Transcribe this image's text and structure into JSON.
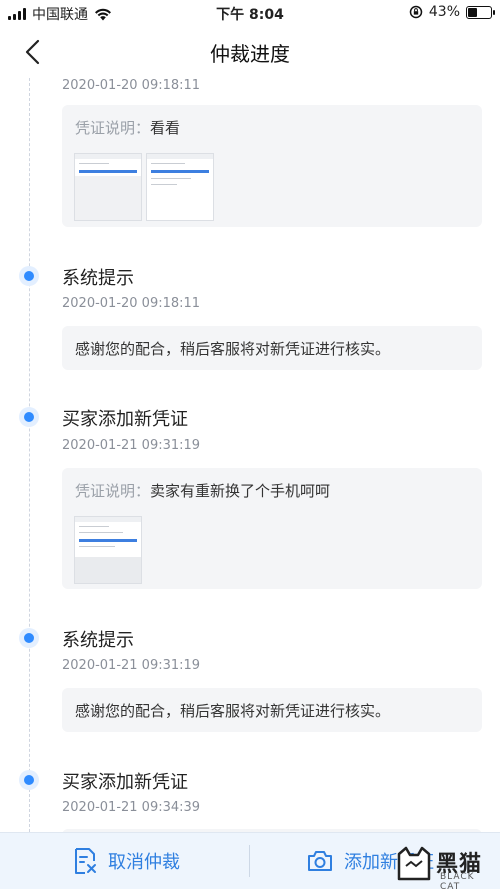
{
  "status_bar": {
    "carrier": "中国联通",
    "time": "下午 8:04",
    "battery_percent": "43%",
    "battery_level": 0.43
  },
  "nav": {
    "title": "仲裁进度"
  },
  "timeline": {
    "entries": [
      {
        "title": "",
        "time": "2020-01-20 09:18:11",
        "label": "凭证说明：",
        "description": "看看",
        "image_count": 2
      },
      {
        "title": "系统提示",
        "time": "2020-01-20 09:18:11",
        "message": "感谢您的配合，稍后客服将对新凭证进行核实。"
      },
      {
        "title": "买家添加新凭证",
        "time": "2020-01-21 09:31:19",
        "label": "凭证说明：",
        "description": "卖家有重新换了个手机呵呵",
        "image_count": 1
      },
      {
        "title": "系统提示",
        "time": "2020-01-21 09:31:19",
        "message": "感谢您的配合，稍后客服将对新凭证进行核实。"
      },
      {
        "title": "买家添加新凭证",
        "time": "2020-01-21 09:34:39"
      }
    ]
  },
  "bottom_bar": {
    "cancel_label": "取消仲裁",
    "add_label": "添加新凭证"
  },
  "watermark": {
    "text": "黑猫",
    "sub": "BLACK CAT"
  },
  "colors": {
    "accent": "#2f7fe0",
    "dot": "#2f8bff",
    "card_bg": "#f4f5f7",
    "bottom_bar_bg": "#eef5fd"
  }
}
